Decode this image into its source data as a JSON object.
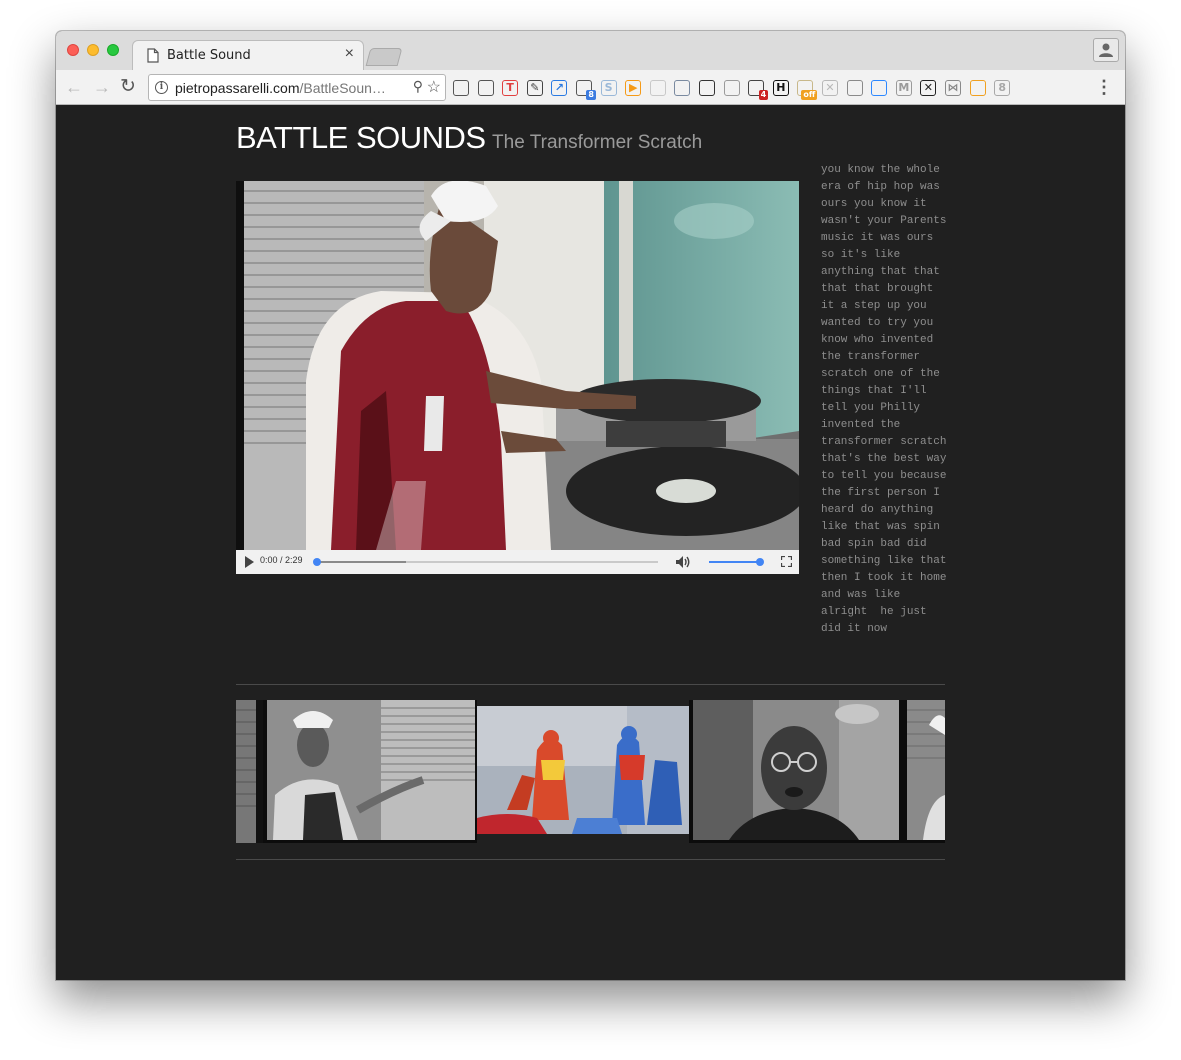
{
  "browser": {
    "tab_title": "Battle Sound",
    "tab_close": "×",
    "url_host": "pietropassarelli.com",
    "url_path": "/BattleSoun…",
    "nav_back": "←",
    "nav_forward": "→",
    "nav_reload": "↻",
    "menu": "⋮",
    "info_glyph": "i",
    "zoom_glyph": "⚲",
    "star_glyph": "☆",
    "extensions": [
      {
        "name": "cast-icon",
        "color": "#555555",
        "glyph": ""
      },
      {
        "name": "password-manager-icon",
        "color": "#555555",
        "glyph": ""
      },
      {
        "name": "translate-extension-icon",
        "color": "#e04040",
        "glyph": "T"
      },
      {
        "name": "pencil-icon",
        "color": "#444444",
        "glyph": "✎"
      },
      {
        "name": "expand-arrow-icon",
        "color": "#2a7ae2",
        "glyph": "↗"
      },
      {
        "name": "clapper-icon",
        "color": "#555555",
        "glyph": "",
        "badge": "8",
        "badge_color": "#3b7be0"
      },
      {
        "name": "skype-icon",
        "color": "#9ab8d8",
        "glyph": "S"
      },
      {
        "name": "play-circle-icon",
        "color": "#f59a17",
        "glyph": "▶"
      },
      {
        "name": "toggle-icon",
        "color": "#c8c8c8",
        "glyph": ""
      },
      {
        "name": "book-icon",
        "color": "#7a8aa0",
        "glyph": ""
      },
      {
        "name": "ghost-icon",
        "color": "#333333",
        "glyph": ""
      },
      {
        "name": "page-icon",
        "color": "#9a9a9a",
        "glyph": ""
      },
      {
        "name": "tool-icon",
        "color": "#444444",
        "glyph": "",
        "badge": "4",
        "badge_color": "#cc2222"
      },
      {
        "name": "h-icon",
        "color": "#111111",
        "glyph": "H"
      },
      {
        "name": "off-extension-icon",
        "color": "#c8b88a",
        "glyph": "",
        "badge": "off",
        "badge_color": "#f0a020"
      },
      {
        "name": "block-icon",
        "color": "#b8b8b8",
        "glyph": "✕"
      },
      {
        "name": "camera-icon",
        "color": "#8a8a8a",
        "glyph": ""
      },
      {
        "name": "messenger-icon",
        "color": "#2d88ff",
        "glyph": ""
      },
      {
        "name": "mail-icon",
        "color": "#9a9a9a",
        "glyph": "M"
      },
      {
        "name": "x-circle-icon",
        "color": "#222222",
        "glyph": "✕"
      },
      {
        "name": "bowtie-icon",
        "color": "#8a8a8a",
        "glyph": "⋈"
      },
      {
        "name": "rss-icon",
        "color": "#f0a020",
        "glyph": ""
      },
      {
        "name": "ghostery-icon",
        "color": "#a8a8a8",
        "glyph": "8"
      }
    ]
  },
  "page": {
    "title": "BATTLE SOUNDS",
    "subtitle": "The Transformer Scratch",
    "video": {
      "time": "0:00 / 2:29",
      "progress_fraction": 0.0,
      "buffered_fraction": 0.26,
      "volume_fraction": 1.0
    },
    "transcript": "you know the whole era of hip hop was ours you know it wasn't your Parents music it was ours  so it's like anything that that that that brought it a step up you wanted to try you know who invented the transformer scratch one of the things that I'll tell you Philly invented the transformer scratch that's the best way to tell you because the first person I heard do anything like that was spin bad spin bad did something like that then I took it home and was like  alright  he just did it now"
  }
}
